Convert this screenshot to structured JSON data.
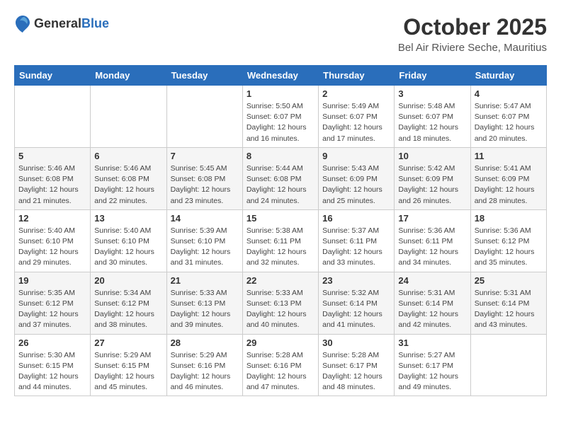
{
  "header": {
    "logo": {
      "general": "General",
      "blue": "Blue"
    },
    "month": "October 2025",
    "location": "Bel Air Riviere Seche, Mauritius"
  },
  "weekdays": [
    "Sunday",
    "Monday",
    "Tuesday",
    "Wednesday",
    "Thursday",
    "Friday",
    "Saturday"
  ],
  "weeks": [
    [
      {
        "day": "",
        "info": ""
      },
      {
        "day": "",
        "info": ""
      },
      {
        "day": "",
        "info": ""
      },
      {
        "day": "1",
        "info": "Sunrise: 5:50 AM\nSunset: 6:07 PM\nDaylight: 12 hours\nand 16 minutes."
      },
      {
        "day": "2",
        "info": "Sunrise: 5:49 AM\nSunset: 6:07 PM\nDaylight: 12 hours\nand 17 minutes."
      },
      {
        "day": "3",
        "info": "Sunrise: 5:48 AM\nSunset: 6:07 PM\nDaylight: 12 hours\nand 18 minutes."
      },
      {
        "day": "4",
        "info": "Sunrise: 5:47 AM\nSunset: 6:07 PM\nDaylight: 12 hours\nand 20 minutes."
      }
    ],
    [
      {
        "day": "5",
        "info": "Sunrise: 5:46 AM\nSunset: 6:08 PM\nDaylight: 12 hours\nand 21 minutes."
      },
      {
        "day": "6",
        "info": "Sunrise: 5:46 AM\nSunset: 6:08 PM\nDaylight: 12 hours\nand 22 minutes."
      },
      {
        "day": "7",
        "info": "Sunrise: 5:45 AM\nSunset: 6:08 PM\nDaylight: 12 hours\nand 23 minutes."
      },
      {
        "day": "8",
        "info": "Sunrise: 5:44 AM\nSunset: 6:08 PM\nDaylight: 12 hours\nand 24 minutes."
      },
      {
        "day": "9",
        "info": "Sunrise: 5:43 AM\nSunset: 6:09 PM\nDaylight: 12 hours\nand 25 minutes."
      },
      {
        "day": "10",
        "info": "Sunrise: 5:42 AM\nSunset: 6:09 PM\nDaylight: 12 hours\nand 26 minutes."
      },
      {
        "day": "11",
        "info": "Sunrise: 5:41 AM\nSunset: 6:09 PM\nDaylight: 12 hours\nand 28 minutes."
      }
    ],
    [
      {
        "day": "12",
        "info": "Sunrise: 5:40 AM\nSunset: 6:10 PM\nDaylight: 12 hours\nand 29 minutes."
      },
      {
        "day": "13",
        "info": "Sunrise: 5:40 AM\nSunset: 6:10 PM\nDaylight: 12 hours\nand 30 minutes."
      },
      {
        "day": "14",
        "info": "Sunrise: 5:39 AM\nSunset: 6:10 PM\nDaylight: 12 hours\nand 31 minutes."
      },
      {
        "day": "15",
        "info": "Sunrise: 5:38 AM\nSunset: 6:11 PM\nDaylight: 12 hours\nand 32 minutes."
      },
      {
        "day": "16",
        "info": "Sunrise: 5:37 AM\nSunset: 6:11 PM\nDaylight: 12 hours\nand 33 minutes."
      },
      {
        "day": "17",
        "info": "Sunrise: 5:36 AM\nSunset: 6:11 PM\nDaylight: 12 hours\nand 34 minutes."
      },
      {
        "day": "18",
        "info": "Sunrise: 5:36 AM\nSunset: 6:12 PM\nDaylight: 12 hours\nand 35 minutes."
      }
    ],
    [
      {
        "day": "19",
        "info": "Sunrise: 5:35 AM\nSunset: 6:12 PM\nDaylight: 12 hours\nand 37 minutes."
      },
      {
        "day": "20",
        "info": "Sunrise: 5:34 AM\nSunset: 6:12 PM\nDaylight: 12 hours\nand 38 minutes."
      },
      {
        "day": "21",
        "info": "Sunrise: 5:33 AM\nSunset: 6:13 PM\nDaylight: 12 hours\nand 39 minutes."
      },
      {
        "day": "22",
        "info": "Sunrise: 5:33 AM\nSunset: 6:13 PM\nDaylight: 12 hours\nand 40 minutes."
      },
      {
        "day": "23",
        "info": "Sunrise: 5:32 AM\nSunset: 6:14 PM\nDaylight: 12 hours\nand 41 minutes."
      },
      {
        "day": "24",
        "info": "Sunrise: 5:31 AM\nSunset: 6:14 PM\nDaylight: 12 hours\nand 42 minutes."
      },
      {
        "day": "25",
        "info": "Sunrise: 5:31 AM\nSunset: 6:14 PM\nDaylight: 12 hours\nand 43 minutes."
      }
    ],
    [
      {
        "day": "26",
        "info": "Sunrise: 5:30 AM\nSunset: 6:15 PM\nDaylight: 12 hours\nand 44 minutes."
      },
      {
        "day": "27",
        "info": "Sunrise: 5:29 AM\nSunset: 6:15 PM\nDaylight: 12 hours\nand 45 minutes."
      },
      {
        "day": "28",
        "info": "Sunrise: 5:29 AM\nSunset: 6:16 PM\nDaylight: 12 hours\nand 46 minutes."
      },
      {
        "day": "29",
        "info": "Sunrise: 5:28 AM\nSunset: 6:16 PM\nDaylight: 12 hours\nand 47 minutes."
      },
      {
        "day": "30",
        "info": "Sunrise: 5:28 AM\nSunset: 6:17 PM\nDaylight: 12 hours\nand 48 minutes."
      },
      {
        "day": "31",
        "info": "Sunrise: 5:27 AM\nSunset: 6:17 PM\nDaylight: 12 hours\nand 49 minutes."
      },
      {
        "day": "",
        "info": ""
      }
    ]
  ]
}
